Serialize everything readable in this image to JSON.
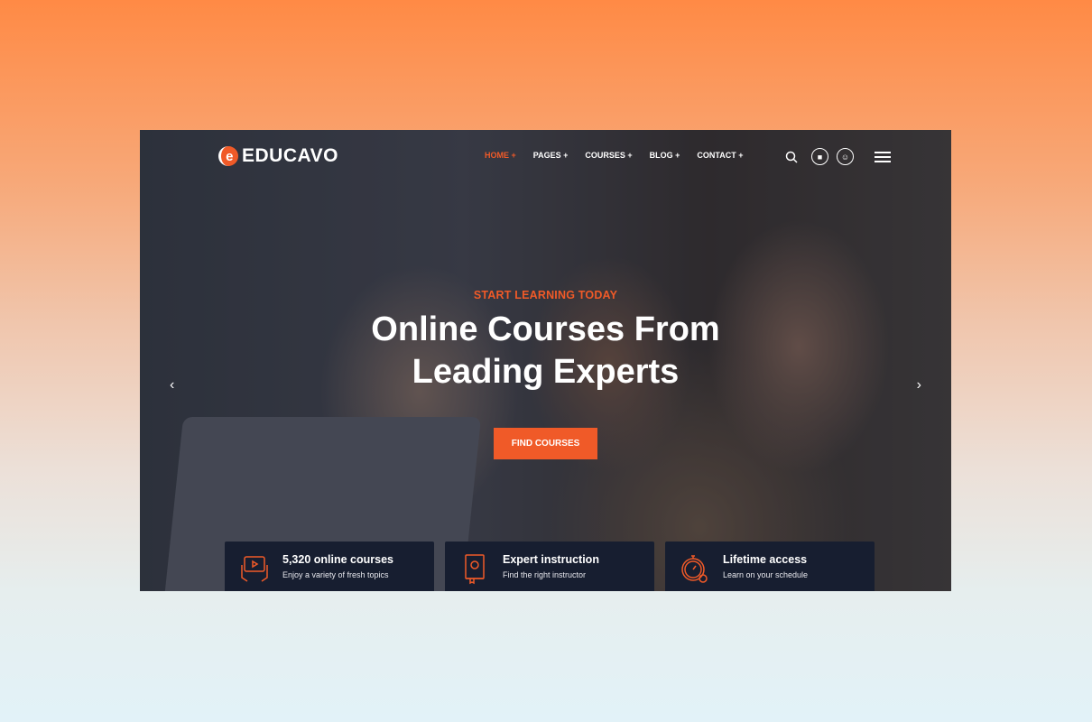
{
  "brand": {
    "name": "EDUCAVO",
    "accent": "#f05a28"
  },
  "nav": {
    "items": [
      {
        "label": "HOME +"
      },
      {
        "label": "PAGES +"
      },
      {
        "label": "COURSES +"
      },
      {
        "label": "BLOG +"
      },
      {
        "label": "CONTACT +"
      }
    ],
    "icons": [
      "search-icon",
      "cart-icon",
      "user-icon",
      "menu-icon"
    ]
  },
  "hero": {
    "eyebrow": "START LEARNING TODAY",
    "title_line1": "Online Courses From",
    "title_line2": "Leading Experts",
    "cta": "FIND COURSES"
  },
  "features": [
    {
      "icon": "tablet-video-icon",
      "title": "5,320 online courses",
      "subtitle": "Enjoy a variety of fresh topics"
    },
    {
      "icon": "book-gear-icon",
      "title": "Expert instruction",
      "subtitle": "Find the right instructor"
    },
    {
      "icon": "stopwatch-icon",
      "title": "Lifetime access",
      "subtitle": "Learn on your schedule"
    }
  ]
}
